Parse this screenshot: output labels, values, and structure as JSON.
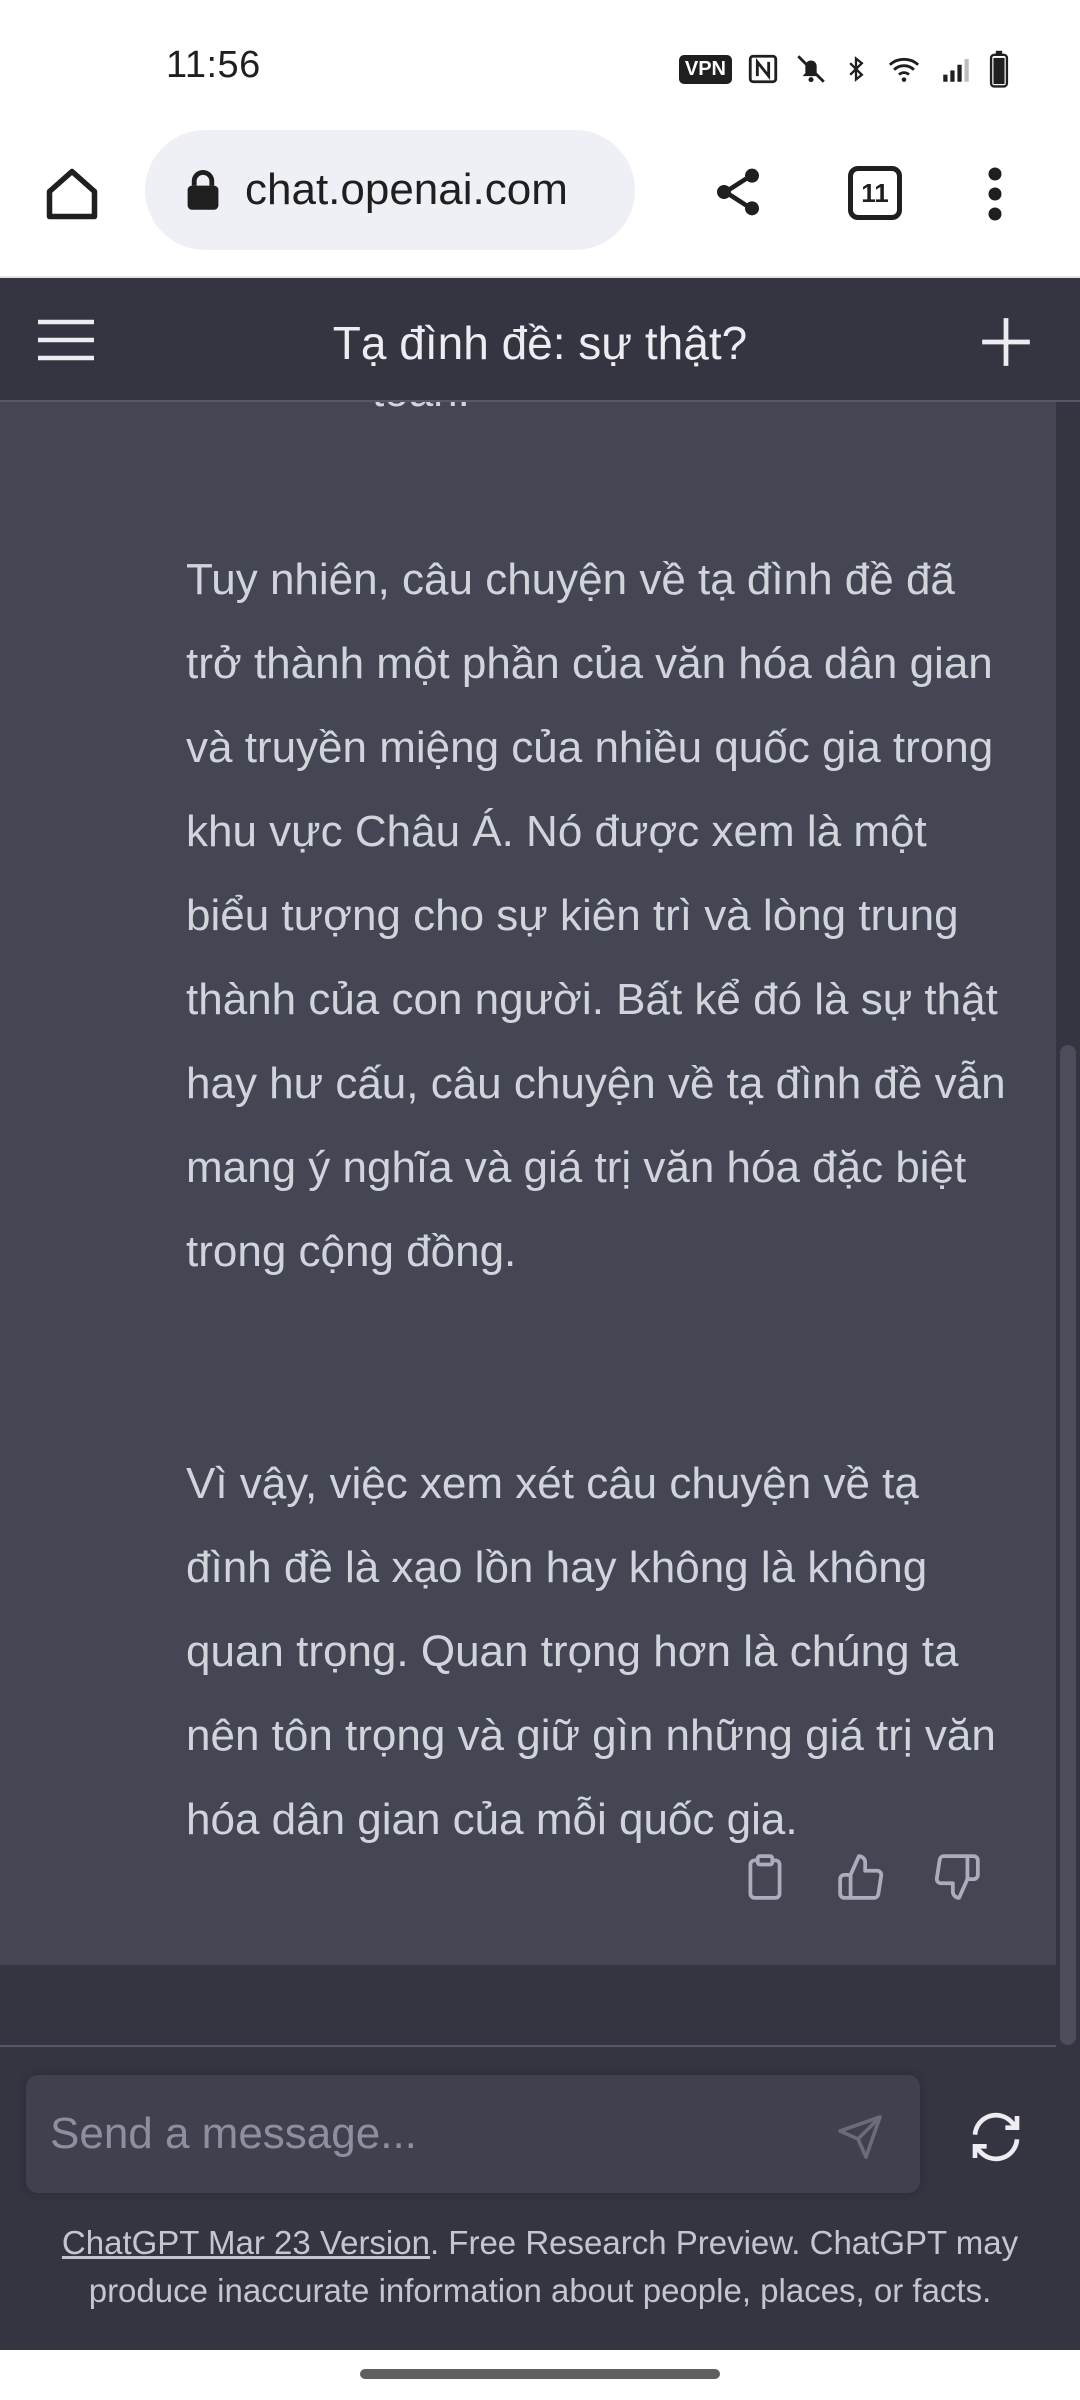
{
  "status_bar": {
    "time": "11:56",
    "vpn_label": "VPN",
    "icons": [
      "vpn-icon",
      "nfc-icon",
      "bell-off-icon",
      "bluetooth-icon",
      "wifi-icon",
      "signal-icon",
      "battery-icon"
    ]
  },
  "browser": {
    "url": "chat.openai.com",
    "tab_count": "11"
  },
  "chat": {
    "title": "Tạ đình đề: sự thật?",
    "cut_line": "toàn.",
    "paragraphs": [
      "Tuy nhiên, câu chuyện về tạ đình đề đã trở thành một phần của văn hóa dân gian và truyền miệng của nhiều quốc gia trong khu vực Châu Á. Nó được xem là một biểu tượng cho sự kiên trì và lòng trung thành của con người. Bất kể đó là sự thật hay hư cấu, câu chuyện về tạ đình đề vẫn mang ý nghĩa và giá trị văn hóa đặc biệt trong cộng đồng.",
      "Vì vậy, việc xem xét câu chuyện về tạ đình đề là xạo lồn hay không là không quan trọng. Quan trọng hơn là chúng ta nên tôn trọng và giữ gìn những giá trị văn hóa dân gian của mỗi quốc gia."
    ]
  },
  "input": {
    "placeholder": "Send a message..."
  },
  "disclaimer": {
    "link_text": "ChatGPT Mar 23 Version",
    "text": ". Free Research Preview. ChatGPT may produce inaccurate information about people, places, or facts."
  },
  "colors": {
    "header_bg": "#343541",
    "message_bg": "#444654",
    "text": "#d1d5db"
  }
}
